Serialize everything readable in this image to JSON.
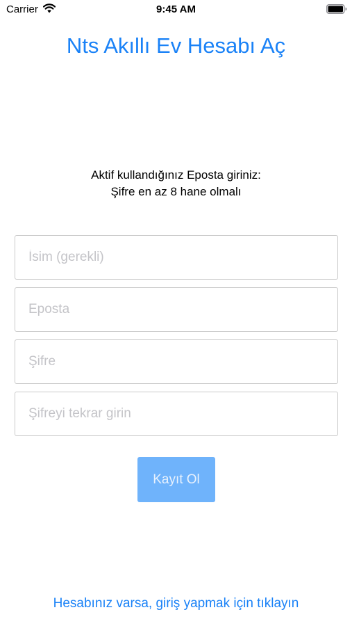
{
  "status_bar": {
    "carrier": "Carrier",
    "time": "9:45 AM",
    "wifi_icon": "wifi-icon",
    "battery_icon": "battery-icon"
  },
  "title": "Nts Akıllı Ev Hesabı Aç",
  "instructions": {
    "line1": "Aktif kullandığınız Eposta giriniz:",
    "line2": "Şifre en az 8 hane olmalı"
  },
  "form": {
    "name": {
      "value": "",
      "placeholder": "İsim (gerekli)"
    },
    "email": {
      "value": "",
      "placeholder": "Eposta"
    },
    "password": {
      "value": "",
      "placeholder": "Şifre"
    },
    "password_repeat": {
      "value": "",
      "placeholder": "Şifreyi tekrar girin"
    },
    "register_label": "Kayıt Ol"
  },
  "login_link": "Hesabınız varsa, giriş yapmak için tıklayın",
  "colors": {
    "accent": "#1a82f7",
    "button_bg": "#6fb3fb",
    "button_text": "#e7f1fd",
    "field_border": "#c9c9c9",
    "placeholder": "#c4c4c8"
  }
}
